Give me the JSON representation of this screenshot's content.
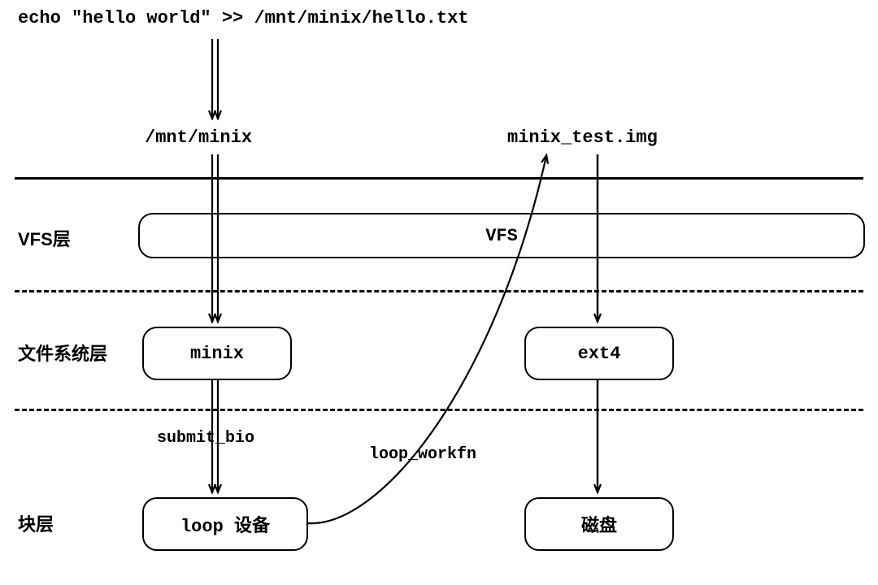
{
  "command": "echo \"hello world\" >> /mnt/minix/hello.txt",
  "mountpoint": "/mnt/minix",
  "image_file": "minix_test.img",
  "layers": {
    "vfs_label": "VFS层",
    "fs_label": "文件系统层",
    "block_label": "块层"
  },
  "nodes": {
    "vfs": "VFS",
    "minix": "minix",
    "ext4": "ext4",
    "loop": "loop 设备",
    "disk": "磁盘"
  },
  "annotations": {
    "submit_bio": "submit_bio",
    "loop_workfn": "loop_workfn"
  }
}
